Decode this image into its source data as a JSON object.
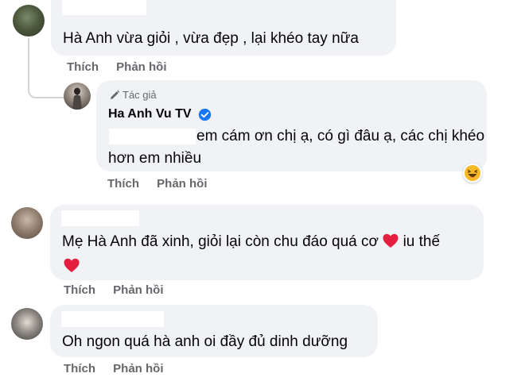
{
  "comments": [
    {
      "text": "Hà Anh vừa giỏi , vừa đẹp , lại khéo tay nữa",
      "like_label": "Thích",
      "reply_label": "Phản hồi"
    },
    {
      "text_line1": "Mẹ Hà Anh đã xinh, giỏi lại còn chu đáo quá cơ",
      "text_line1_suffix": "iu thế",
      "like_label": "Thích",
      "reply_label": "Phản hồi"
    },
    {
      "text": "Oh ngon quá hà anh oi đầy đủ dinh dưỡng",
      "like_label": "Thích",
      "reply_label": "Phản hồi"
    }
  ],
  "reply": {
    "author_tag": "Tác giả",
    "author_name": "Ha Anh Vu TV",
    "text_line1": "em cám ơn chị ạ, có gì đâu ạ, các chị khéo",
    "text_line2": "hơn em nhiều",
    "like_label": "Thích",
    "reply_label": "Phản hồi",
    "reaction_icon": "haha-emoji-icon"
  },
  "colors": {
    "bubble": "#f0f2f5",
    "action_text": "#65676b",
    "verified": "#1877f2",
    "heart": "#e41e3f",
    "haha": "#f7b928"
  }
}
